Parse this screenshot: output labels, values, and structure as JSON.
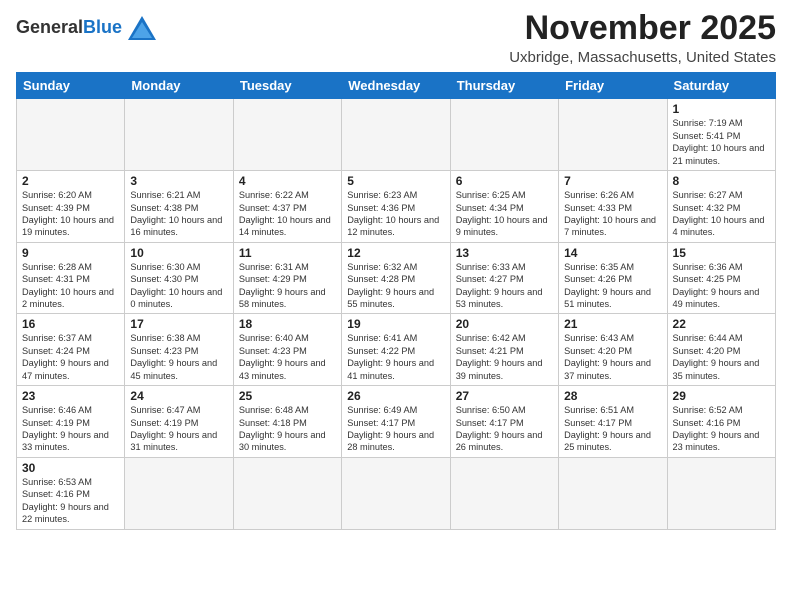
{
  "header": {
    "logo_general": "General",
    "logo_blue": "Blue",
    "month_title": "November 2025",
    "location": "Uxbridge, Massachusetts, United States"
  },
  "days_of_week": [
    "Sunday",
    "Monday",
    "Tuesday",
    "Wednesday",
    "Thursday",
    "Friday",
    "Saturday"
  ],
  "weeks": [
    [
      {
        "day": "",
        "info": ""
      },
      {
        "day": "",
        "info": ""
      },
      {
        "day": "",
        "info": ""
      },
      {
        "day": "",
        "info": ""
      },
      {
        "day": "",
        "info": ""
      },
      {
        "day": "",
        "info": ""
      },
      {
        "day": "1",
        "info": "Sunrise: 7:19 AM\nSunset: 5:41 PM\nDaylight: 10 hours and 21 minutes."
      }
    ],
    [
      {
        "day": "2",
        "info": "Sunrise: 6:20 AM\nSunset: 4:39 PM\nDaylight: 10 hours and 19 minutes."
      },
      {
        "day": "3",
        "info": "Sunrise: 6:21 AM\nSunset: 4:38 PM\nDaylight: 10 hours and 16 minutes."
      },
      {
        "day": "4",
        "info": "Sunrise: 6:22 AM\nSunset: 4:37 PM\nDaylight: 10 hours and 14 minutes."
      },
      {
        "day": "5",
        "info": "Sunrise: 6:23 AM\nSunset: 4:36 PM\nDaylight: 10 hours and 12 minutes."
      },
      {
        "day": "6",
        "info": "Sunrise: 6:25 AM\nSunset: 4:34 PM\nDaylight: 10 hours and 9 minutes."
      },
      {
        "day": "7",
        "info": "Sunrise: 6:26 AM\nSunset: 4:33 PM\nDaylight: 10 hours and 7 minutes."
      },
      {
        "day": "8",
        "info": "Sunrise: 6:27 AM\nSunset: 4:32 PM\nDaylight: 10 hours and 4 minutes."
      }
    ],
    [
      {
        "day": "9",
        "info": "Sunrise: 6:28 AM\nSunset: 4:31 PM\nDaylight: 10 hours and 2 minutes."
      },
      {
        "day": "10",
        "info": "Sunrise: 6:30 AM\nSunset: 4:30 PM\nDaylight: 10 hours and 0 minutes."
      },
      {
        "day": "11",
        "info": "Sunrise: 6:31 AM\nSunset: 4:29 PM\nDaylight: 9 hours and 58 minutes."
      },
      {
        "day": "12",
        "info": "Sunrise: 6:32 AM\nSunset: 4:28 PM\nDaylight: 9 hours and 55 minutes."
      },
      {
        "day": "13",
        "info": "Sunrise: 6:33 AM\nSunset: 4:27 PM\nDaylight: 9 hours and 53 minutes."
      },
      {
        "day": "14",
        "info": "Sunrise: 6:35 AM\nSunset: 4:26 PM\nDaylight: 9 hours and 51 minutes."
      },
      {
        "day": "15",
        "info": "Sunrise: 6:36 AM\nSunset: 4:25 PM\nDaylight: 9 hours and 49 minutes."
      }
    ],
    [
      {
        "day": "16",
        "info": "Sunrise: 6:37 AM\nSunset: 4:24 PM\nDaylight: 9 hours and 47 minutes."
      },
      {
        "day": "17",
        "info": "Sunrise: 6:38 AM\nSunset: 4:23 PM\nDaylight: 9 hours and 45 minutes."
      },
      {
        "day": "18",
        "info": "Sunrise: 6:40 AM\nSunset: 4:23 PM\nDaylight: 9 hours and 43 minutes."
      },
      {
        "day": "19",
        "info": "Sunrise: 6:41 AM\nSunset: 4:22 PM\nDaylight: 9 hours and 41 minutes."
      },
      {
        "day": "20",
        "info": "Sunrise: 6:42 AM\nSunset: 4:21 PM\nDaylight: 9 hours and 39 minutes."
      },
      {
        "day": "21",
        "info": "Sunrise: 6:43 AM\nSunset: 4:20 PM\nDaylight: 9 hours and 37 minutes."
      },
      {
        "day": "22",
        "info": "Sunrise: 6:44 AM\nSunset: 4:20 PM\nDaylight: 9 hours and 35 minutes."
      }
    ],
    [
      {
        "day": "23",
        "info": "Sunrise: 6:46 AM\nSunset: 4:19 PM\nDaylight: 9 hours and 33 minutes."
      },
      {
        "day": "24",
        "info": "Sunrise: 6:47 AM\nSunset: 4:19 PM\nDaylight: 9 hours and 31 minutes."
      },
      {
        "day": "25",
        "info": "Sunrise: 6:48 AM\nSunset: 4:18 PM\nDaylight: 9 hours and 30 minutes."
      },
      {
        "day": "26",
        "info": "Sunrise: 6:49 AM\nSunset: 4:17 PM\nDaylight: 9 hours and 28 minutes."
      },
      {
        "day": "27",
        "info": "Sunrise: 6:50 AM\nSunset: 4:17 PM\nDaylight: 9 hours and 26 minutes."
      },
      {
        "day": "28",
        "info": "Sunrise: 6:51 AM\nSunset: 4:17 PM\nDaylight: 9 hours and 25 minutes."
      },
      {
        "day": "29",
        "info": "Sunrise: 6:52 AM\nSunset: 4:16 PM\nDaylight: 9 hours and 23 minutes."
      }
    ],
    [
      {
        "day": "30",
        "info": "Sunrise: 6:53 AM\nSunset: 4:16 PM\nDaylight: 9 hours and 22 minutes."
      },
      {
        "day": "",
        "info": ""
      },
      {
        "day": "",
        "info": ""
      },
      {
        "day": "",
        "info": ""
      },
      {
        "day": "",
        "info": ""
      },
      {
        "day": "",
        "info": ""
      },
      {
        "day": "",
        "info": ""
      }
    ]
  ]
}
